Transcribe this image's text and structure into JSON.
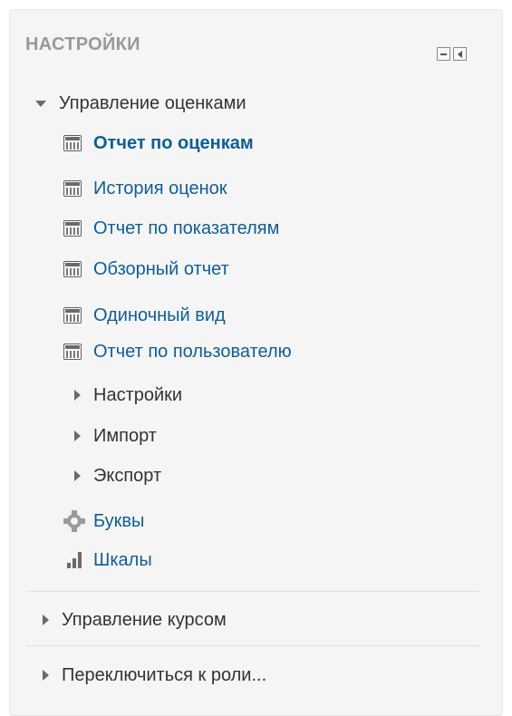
{
  "block": {
    "title": "НАСТРОЙКИ",
    "controls": [
      "hide-icon",
      "dock-icon"
    ]
  },
  "grades": {
    "section_label": "Управление оценками",
    "reports": [
      {
        "label": "Отчет по оценкам",
        "active": true,
        "icon": "report-icon"
      },
      {
        "label": "История оценок",
        "icon": "report-icon"
      },
      {
        "label": "Отчет по показателям",
        "icon": "report-icon"
      },
      {
        "label": "Обзорный отчет",
        "icon": "report-icon"
      },
      {
        "label": "Одиночный вид",
        "icon": "report-icon"
      },
      {
        "label": "Отчет по пользователю",
        "icon": "report-icon"
      }
    ],
    "collapsed": [
      {
        "label": "Настройки"
      },
      {
        "label": "Импорт"
      },
      {
        "label": "Экспорт"
      }
    ],
    "letters_label": "Буквы",
    "scales_label": "Шкалы"
  },
  "course_admin": {
    "label": "Управление курсом"
  },
  "switch_role": {
    "label": "Переключиться к роли..."
  },
  "colors": {
    "link": "#0f5e93",
    "text": "#333333",
    "title": "#999999",
    "block_bg": "#f5f5f5"
  }
}
